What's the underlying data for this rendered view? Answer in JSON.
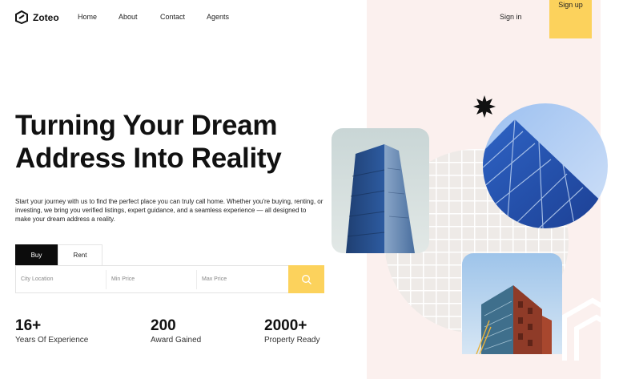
{
  "brand": {
    "name": "Zoteo"
  },
  "nav": {
    "items": [
      {
        "label": "Home"
      },
      {
        "label": "About"
      },
      {
        "label": "Contact"
      },
      {
        "label": "Agents"
      }
    ],
    "sign_in": "Sign in",
    "sign_up": "Sign up"
  },
  "hero": {
    "title_line1": "Turning Your Dream",
    "title_line2": "Address Into Reality",
    "description": "Start your journey with us to find the perfect place you can truly call home. Whether you're buying, renting, or investing, we bring you verified listings, expert guidance, and a seamless experience — all designed to make your dream address a reality."
  },
  "search": {
    "tabs": [
      {
        "label": "Buy",
        "active": true
      },
      {
        "label": "Rent",
        "active": false
      }
    ],
    "city_placeholder": "City Location",
    "min_placeholder": "Min Price",
    "max_placeholder": "Max Price",
    "button_icon": "search-icon"
  },
  "stats": [
    {
      "value": "16+",
      "label": "Years Of Experience"
    },
    {
      "value": "200",
      "label": "Award Gained"
    },
    {
      "value": "2000+",
      "label": "Property Ready"
    }
  ],
  "colors": {
    "accent": "#fcd25c",
    "panel": "#fbf0ee",
    "dark": "#0c0c0c"
  }
}
